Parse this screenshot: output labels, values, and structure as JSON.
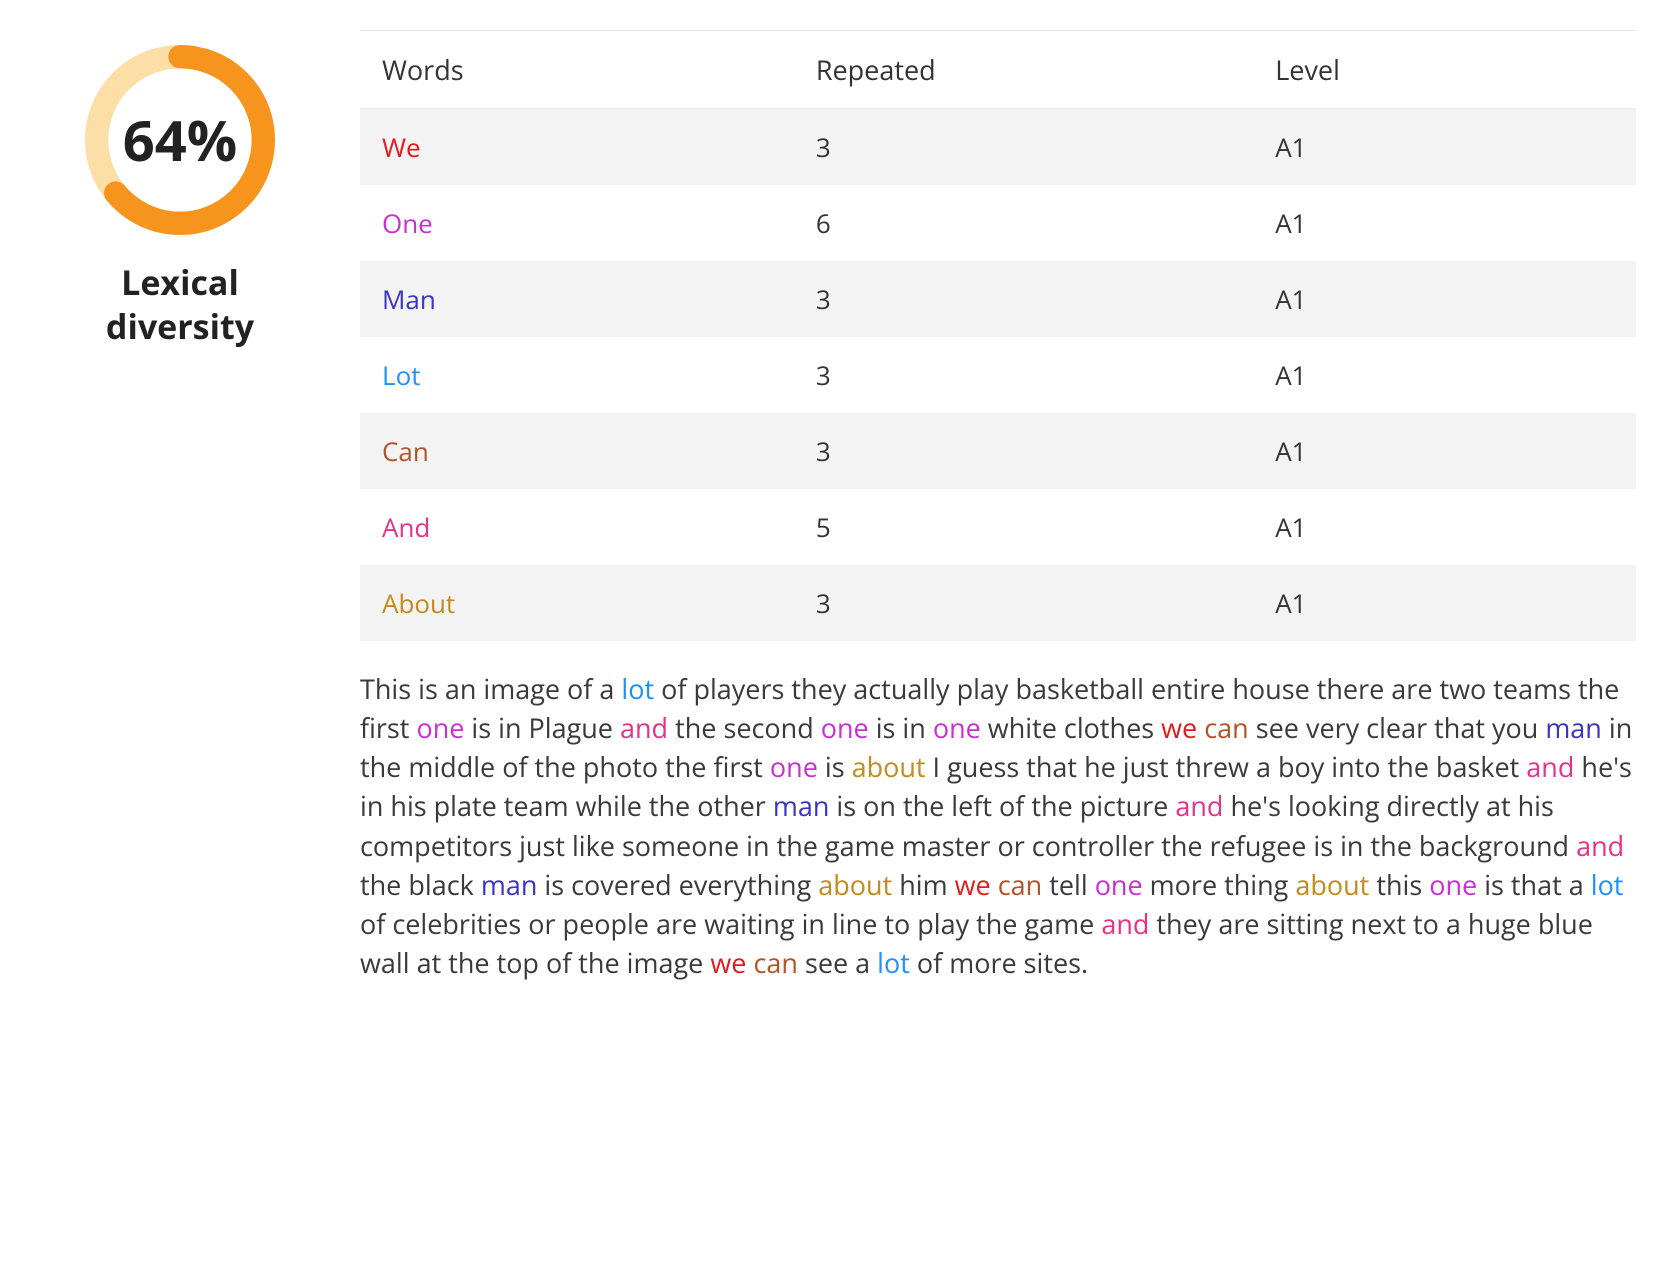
{
  "gauge": {
    "percent": 64,
    "percent_display": "64%",
    "title_l1": "Lexical",
    "title_l2": "diversity",
    "track_color": "#fcdfa6",
    "fill_color": "#f7941d"
  },
  "table": {
    "headers": {
      "words": "Words",
      "repeated": "Repeated",
      "level": "Level"
    },
    "rows": [
      {
        "word": "We",
        "color": "#e41a1c",
        "repeated": "3",
        "level": "A1"
      },
      {
        "word": "One",
        "color": "#c92fd1",
        "repeated": "6",
        "level": "A1"
      },
      {
        "word": "Man",
        "color": "#3b35c4",
        "repeated": "3",
        "level": "A1"
      },
      {
        "word": "Lot",
        "color": "#1e90ff",
        "repeated": "3",
        "level": "A1"
      },
      {
        "word": "Can",
        "color": "#b1542a",
        "repeated": "3",
        "level": "A1"
      },
      {
        "word": "And",
        "color": "#e73289",
        "repeated": "5",
        "level": "A1"
      },
      {
        "word": "About",
        "color": "#c38a1e",
        "repeated": "3",
        "level": "A1"
      }
    ]
  },
  "passage": {
    "segments": [
      {
        "t": "This is an image of a "
      },
      {
        "t": "lot",
        "c": "#1e90ff"
      },
      {
        "t": " of players they actually play basketball entire house there are two teams the first "
      },
      {
        "t": "one",
        "c": "#c92fd1"
      },
      {
        "t": " is in Plague "
      },
      {
        "t": "and",
        "c": "#e73289"
      },
      {
        "t": " the second "
      },
      {
        "t": "one",
        "c": "#c92fd1"
      },
      {
        "t": " is in "
      },
      {
        "t": "one",
        "c": "#c92fd1"
      },
      {
        "t": " white clothes "
      },
      {
        "t": "we",
        "c": "#e41a1c"
      },
      {
        "t": " "
      },
      {
        "t": "can",
        "c": "#b1542a"
      },
      {
        "t": " see very clear that you "
      },
      {
        "t": "man",
        "c": "#3b35c4"
      },
      {
        "t": " in the middle of the photo the first "
      },
      {
        "t": "one",
        "c": "#c92fd1"
      },
      {
        "t": " is "
      },
      {
        "t": "about",
        "c": "#c38a1e"
      },
      {
        "t": " I guess that he just threw a boy into the basket "
      },
      {
        "t": "and",
        "c": "#e73289"
      },
      {
        "t": " he's in his plate team while the other "
      },
      {
        "t": "man",
        "c": "#3b35c4"
      },
      {
        "t": " is on the left of the picture "
      },
      {
        "t": "and",
        "c": "#e73289"
      },
      {
        "t": " he's looking directly at his competitors just like someone in the game master or controller the refugee is in the background "
      },
      {
        "t": "and",
        "c": "#e73289"
      },
      {
        "t": " the black "
      },
      {
        "t": "man",
        "c": "#3b35c4"
      },
      {
        "t": " is covered everything "
      },
      {
        "t": "about",
        "c": "#c38a1e"
      },
      {
        "t": " him "
      },
      {
        "t": "we",
        "c": "#e41a1c"
      },
      {
        "t": " "
      },
      {
        "t": "can",
        "c": "#b1542a"
      },
      {
        "t": " tell "
      },
      {
        "t": "one",
        "c": "#c92fd1"
      },
      {
        "t": " more thing "
      },
      {
        "t": "about",
        "c": "#c38a1e"
      },
      {
        "t": " this "
      },
      {
        "t": "one",
        "c": "#c92fd1"
      },
      {
        "t": " is that a "
      },
      {
        "t": "lot",
        "c": "#1e90ff"
      },
      {
        "t": " of celebrities or people are waiting in line to play the game "
      },
      {
        "t": "and",
        "c": "#e73289"
      },
      {
        "t": " they are sitting next to a huge blue wall at the top of the image "
      },
      {
        "t": "we",
        "c": "#e41a1c"
      },
      {
        "t": " "
      },
      {
        "t": "can",
        "c": "#b1542a"
      },
      {
        "t": " see a "
      },
      {
        "t": "lot",
        "c": "#1e90ff"
      },
      {
        "t": " of more sites."
      }
    ]
  }
}
